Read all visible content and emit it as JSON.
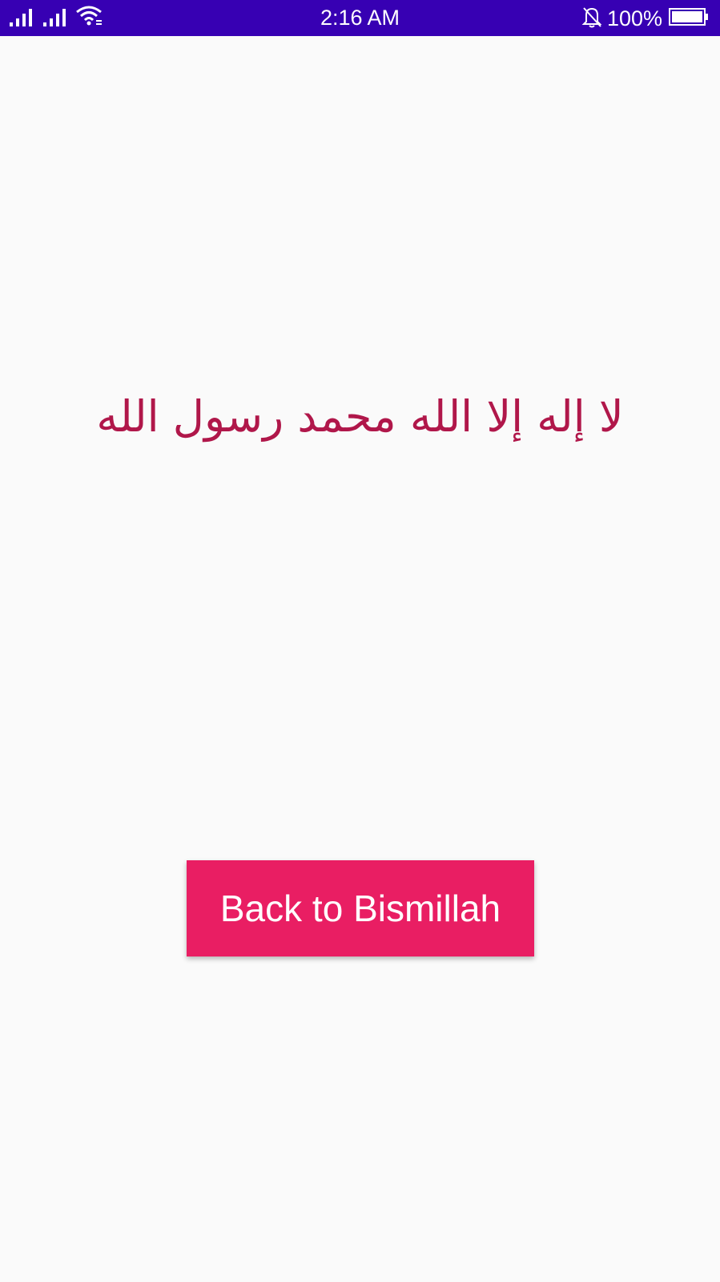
{
  "status_bar": {
    "time": "2:16 AM",
    "battery_percent": "100%",
    "battery_level": 1.0,
    "icons": [
      "signal-icon",
      "signal-icon",
      "wifi-icon",
      "bell-off-icon",
      "battery-icon"
    ],
    "background_color": "#3700b3"
  },
  "main": {
    "shahada_text": "لا إله إلا الله محمد رسول الله",
    "text_color": "#b0174a"
  },
  "button": {
    "label": "Back to Bismillah",
    "color": "#e91e63"
  }
}
